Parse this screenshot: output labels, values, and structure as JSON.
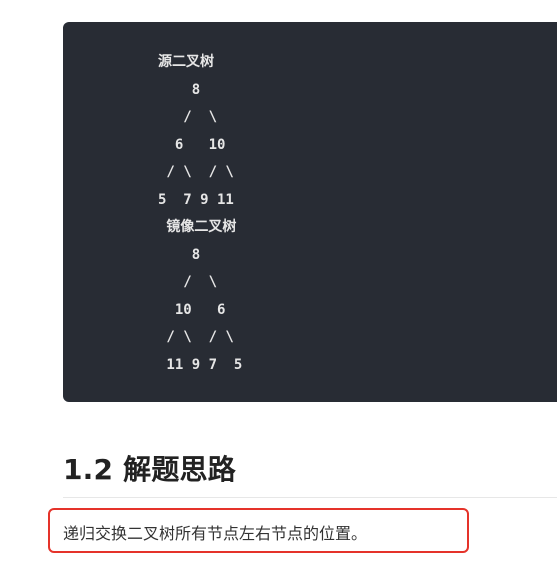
{
  "code_block": {
    "lines": [
      "源二叉树",
      "    8",
      "   /  \\",
      "  6   10",
      " / \\  / \\",
      "5  7 9 11",
      " 镜像二叉树",
      "    8",
      "   /  \\",
      "  10   6",
      " / \\  / \\",
      " 11 9 7  5"
    ]
  },
  "section": {
    "heading": "1.2 解题思路",
    "paragraph": "递归交换二叉树所有节点左右节点的位置。"
  },
  "colors": {
    "code_background": "#282c34",
    "highlight_border": "#e5332a"
  }
}
